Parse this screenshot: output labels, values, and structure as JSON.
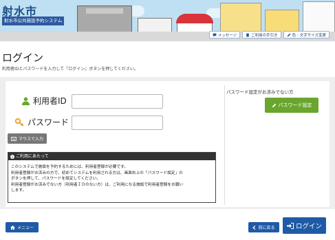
{
  "header": {
    "site_title": "射水市",
    "site_subtitle": "射水市公共施設予約システム",
    "links": [
      {
        "label": "メッセージ",
        "icon": "comment-icon"
      },
      {
        "label": "ご利用の手引き",
        "icon": "book-icon"
      },
      {
        "label": "色・文字サイズ変更",
        "icon": "pencil-icon"
      }
    ]
  },
  "page": {
    "title": "ログイン",
    "description": "利用者IDとパスワードを入力して『ログイン』ボタンを押してください。"
  },
  "form": {
    "user_id_label": "利用者ID",
    "user_id_value": "",
    "password_label": "パスワード",
    "password_value": "",
    "mouse_input_label": "マウスで入力"
  },
  "notice": {
    "heading": "ご利用にあたって",
    "lines": [
      "このシステムで施設を予約するためには、利用者登録が必要です。",
      "利用者登録がお済みの方で、初めてシステムを利用される方は、画面右上の「パスワード設定」の",
      "ボタンを押して、パスワードを設定してください。",
      "利用者登録がお済みでない方（利用者ＩＤのない方）は、ご利用になる施設で利用者登録をお願い",
      "します。"
    ]
  },
  "password_setup": {
    "note": "パスワード設定がお済みでない方",
    "button_label": "パスワード設定"
  },
  "footer": {
    "menu_label": "メニュー",
    "back_label": "前に戻る",
    "login_label": "ログイン"
  },
  "colors": {
    "accent_blue": "#1f5aa6",
    "green": "#6aa62e",
    "icon_green": "#6aa62e",
    "icon_orange": "#e8a317"
  }
}
